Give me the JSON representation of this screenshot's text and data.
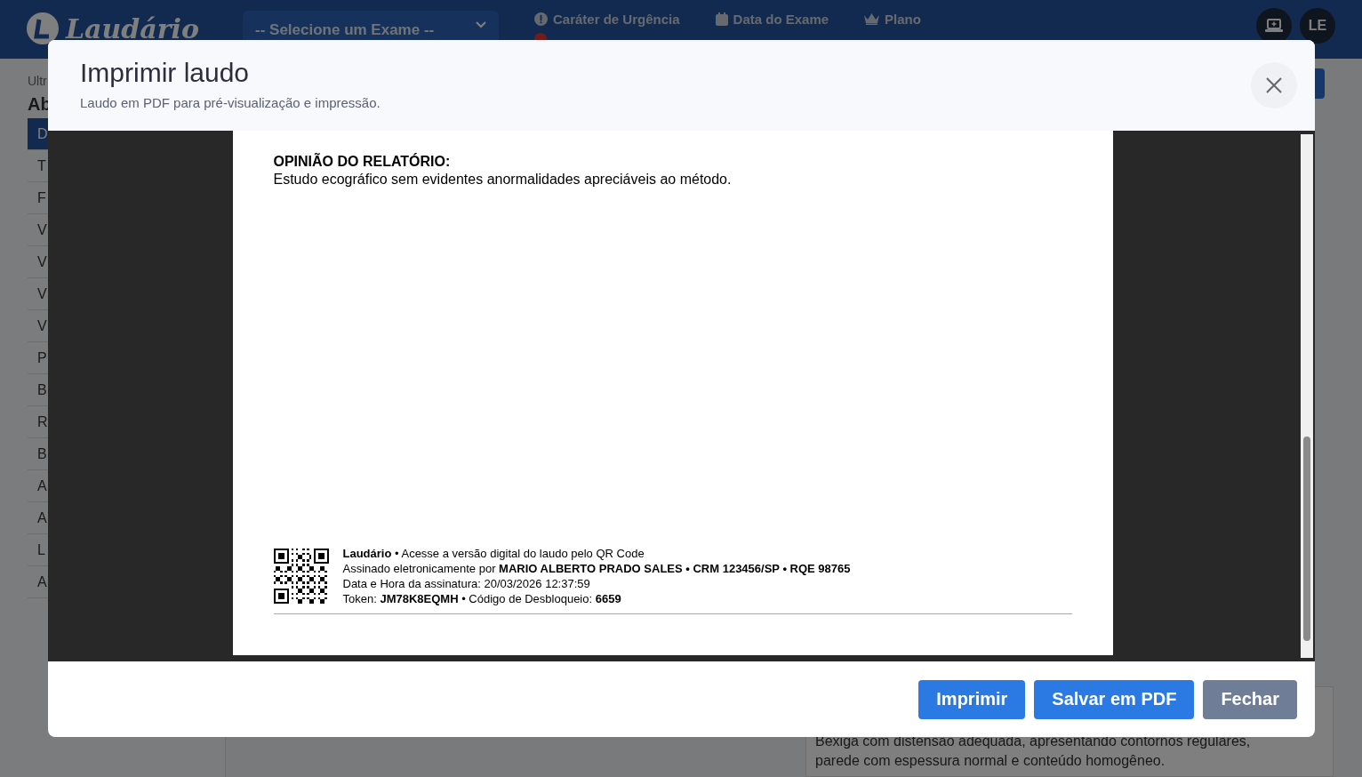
{
  "app_header": {
    "logo": "Laudário",
    "exam_select": {
      "value": "-- Selecione um Exame --"
    },
    "info": [
      {
        "label": "Caráter de Urgência"
      },
      {
        "label": "Data do Exame"
      },
      {
        "label": "Plano"
      }
    ],
    "avatar": "LE"
  },
  "sidebar": {
    "caption": "Ultr",
    "title": "Ab",
    "items": [
      {
        "label": "D",
        "selected": true
      },
      {
        "label": "T",
        "selected": false
      },
      {
        "label": "F",
        "selected": false
      },
      {
        "label": "V",
        "selected": false
      },
      {
        "label": "V",
        "selected": false
      },
      {
        "label": "V",
        "selected": false
      },
      {
        "label": "V",
        "selected": false
      },
      {
        "label": "P",
        "selected": false
      },
      {
        "label": "B",
        "selected": false
      },
      {
        "label": "R",
        "selected": false
      },
      {
        "label": "B",
        "selected": false
      },
      {
        "label": "A",
        "selected": false
      },
      {
        "label": "A",
        "selected": false
      },
      {
        "label": "L",
        "selected": false
      },
      {
        "label": "A",
        "selected": false
      }
    ]
  },
  "background_text": "Bexiga com distensão adequada, apresentando contornos regulares, parede com espessura normal e conteúdo homogêneo.",
  "modal": {
    "title": "Imprimir laudo",
    "subtitle": "Laudo em PDF para pré-visualização e impressão.",
    "document": {
      "section_heading": "OPINIÃO DO RELATÓRIO:",
      "section_text": "Estudo ecográfico sem evidentes anormalidades apreciáveis ao método.",
      "signature_lines": [
        "**Laudário** • Acesse a versão digital do laudo pelo QR Code",
        "Assinado eletronicamente por **MARIO ALBERTO PRADO SALES • CRM 123456/SP • RQE 98765**",
        "Data e Hora da assinatura: 20/03/2026 12:37:59",
        "Token: **JM78K8EQMH** • Código de Desbloqueio: **6659**"
      ]
    },
    "buttons": [
      {
        "label": "Imprimir",
        "kind": "primary"
      },
      {
        "label": "Salvar em PDF",
        "kind": "primary"
      },
      {
        "label": "Fechar",
        "kind": "secondary"
      }
    ]
  }
}
